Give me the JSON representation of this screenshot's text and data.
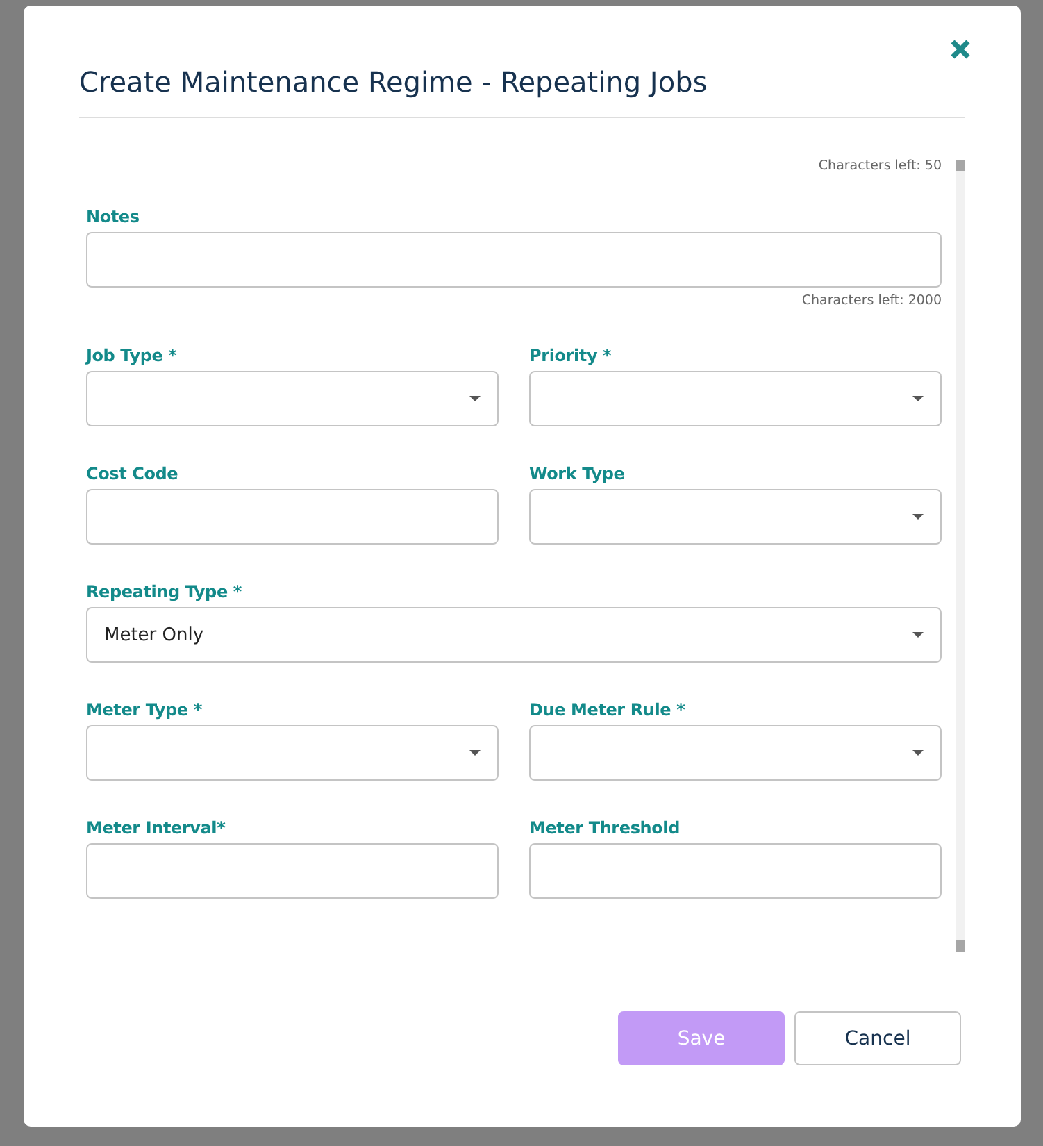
{
  "dialog": {
    "title": "Create Maintenance Regime - Repeating Jobs",
    "top_counter": "Characters left: 50",
    "rows": [
      {
        "fields": [
          {
            "label": "Notes",
            "kind": "text",
            "counter": "Characters left: 2000"
          }
        ]
      },
      {
        "fields": [
          {
            "label": "Job Type *",
            "kind": "select"
          },
          {
            "label": "Priority *",
            "kind": "select"
          }
        ]
      },
      {
        "fields": [
          {
            "label": "Cost Code",
            "kind": "text"
          },
          {
            "label": "Work Type",
            "kind": "select"
          }
        ]
      },
      {
        "fields": [
          {
            "label": "Repeating Type *",
            "kind": "select",
            "value": "Meter Only"
          }
        ]
      },
      {
        "fields": [
          {
            "label": "Meter Type *",
            "kind": "select"
          },
          {
            "label": "Due Meter Rule *",
            "kind": "select"
          }
        ]
      },
      {
        "fields": [
          {
            "label": "Meter Interval*",
            "kind": "text"
          },
          {
            "label": "Meter Threshold",
            "kind": "text"
          }
        ]
      }
    ],
    "buttons": [
      {
        "label": "Save",
        "kind": "primary",
        "disabled": true
      },
      {
        "label": "Cancel",
        "kind": "secondary",
        "disabled": false
      }
    ]
  }
}
